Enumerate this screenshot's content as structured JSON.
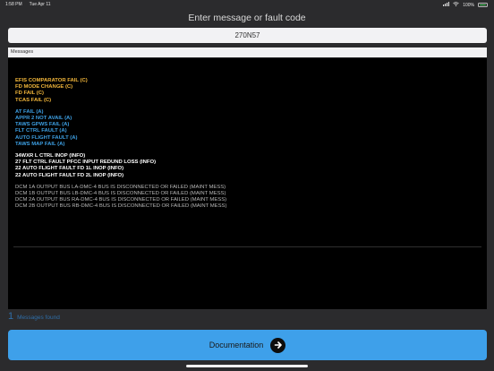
{
  "status_bar": {
    "time": "1:58 PM",
    "date": "Tue Apr 11",
    "battery_percent": "100%",
    "battery_level": 1.0
  },
  "header": {
    "title": "Enter message or fault code"
  },
  "search": {
    "value": "270N57"
  },
  "messages_panel": {
    "label": "Messages",
    "groups": [
      {
        "type": "caution",
        "color": "#f2b63a",
        "items": [
          "EFIS COMPARATOR FAIL (C)",
          "FD MODE CHANGE (C)",
          "FD FAIL (C)",
          "TCAS FAIL (C)"
        ]
      },
      {
        "type": "advisory",
        "color": "#3d9fe3",
        "items": [
          "AT FAIL (A)",
          "APPR 2 NOT AVAIL (A)",
          "TAWS GPWS FAIL (A)",
          "FLT CTRL FAULT (A)",
          "AUTO FLIGHT FAULT (A)",
          "TAWS MAP FAIL (A)"
        ]
      },
      {
        "type": "info",
        "color": "#ffffff",
        "items": [
          "34WXR L CTRL INOP (INFO)",
          "27 FLT CTRL FAULT PFCC INPUT REDUND LOSS (INFO)",
          "22 AUTO FLIGHT FAULT FD 1L INOP (INFO)",
          "22 AUTO FLIGHT FAULT FD 2L INOP (INFO)"
        ]
      },
      {
        "type": "maint",
        "color": "#b8b8b8",
        "items": [
          "DCM 1A OUTPUT BUS LA-DMC-4 BUS IS DISCONNECTED OR FAILED  (MAINT MESS)",
          "DCM 1B OUTPUT BUS LB-DMC-4 BUS IS DISCONNECTED OR FAILED (MAINT MESS)",
          "DCM 2A OUTPUT BUS RA-DMC-4 BUS IS DISCONNECTED OR FAILED  (MAINT MESS)",
          "DCM 2B OUTPUT BUS RB-DMC-4 BUS IS DISCONNECTED OR FAILED  (MAINT MESS)"
        ]
      }
    ]
  },
  "results": {
    "count": "1",
    "label": "Messages found"
  },
  "footer": {
    "button_label": "Documentation",
    "button_color": "#3ea0ea",
    "button_icon": "arrow-right-circle-icon"
  }
}
